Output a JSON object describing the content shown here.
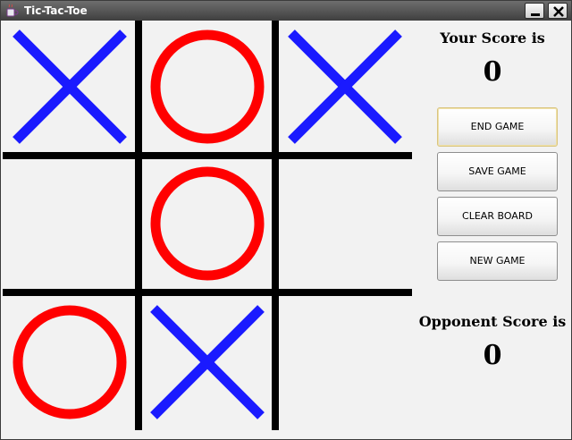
{
  "window": {
    "title": "Tic-Tac-Toe"
  },
  "board": {
    "cells": [
      "X",
      "O",
      "X",
      "",
      "O",
      "",
      "O",
      "X",
      ""
    ],
    "x_color": "#1a1aff",
    "o_color": "#ff0000",
    "grid_color": "#000000",
    "background": "#f2f2f2"
  },
  "scores": {
    "your_label": "Your Score is",
    "your_value": "0",
    "opponent_label": "Opponent Score is",
    "opponent_value": "0"
  },
  "buttons": {
    "end_game": "END GAME",
    "save_game": "SAVE GAME",
    "clear_board": "CLEAR BOARD",
    "new_game": "NEW GAME"
  }
}
